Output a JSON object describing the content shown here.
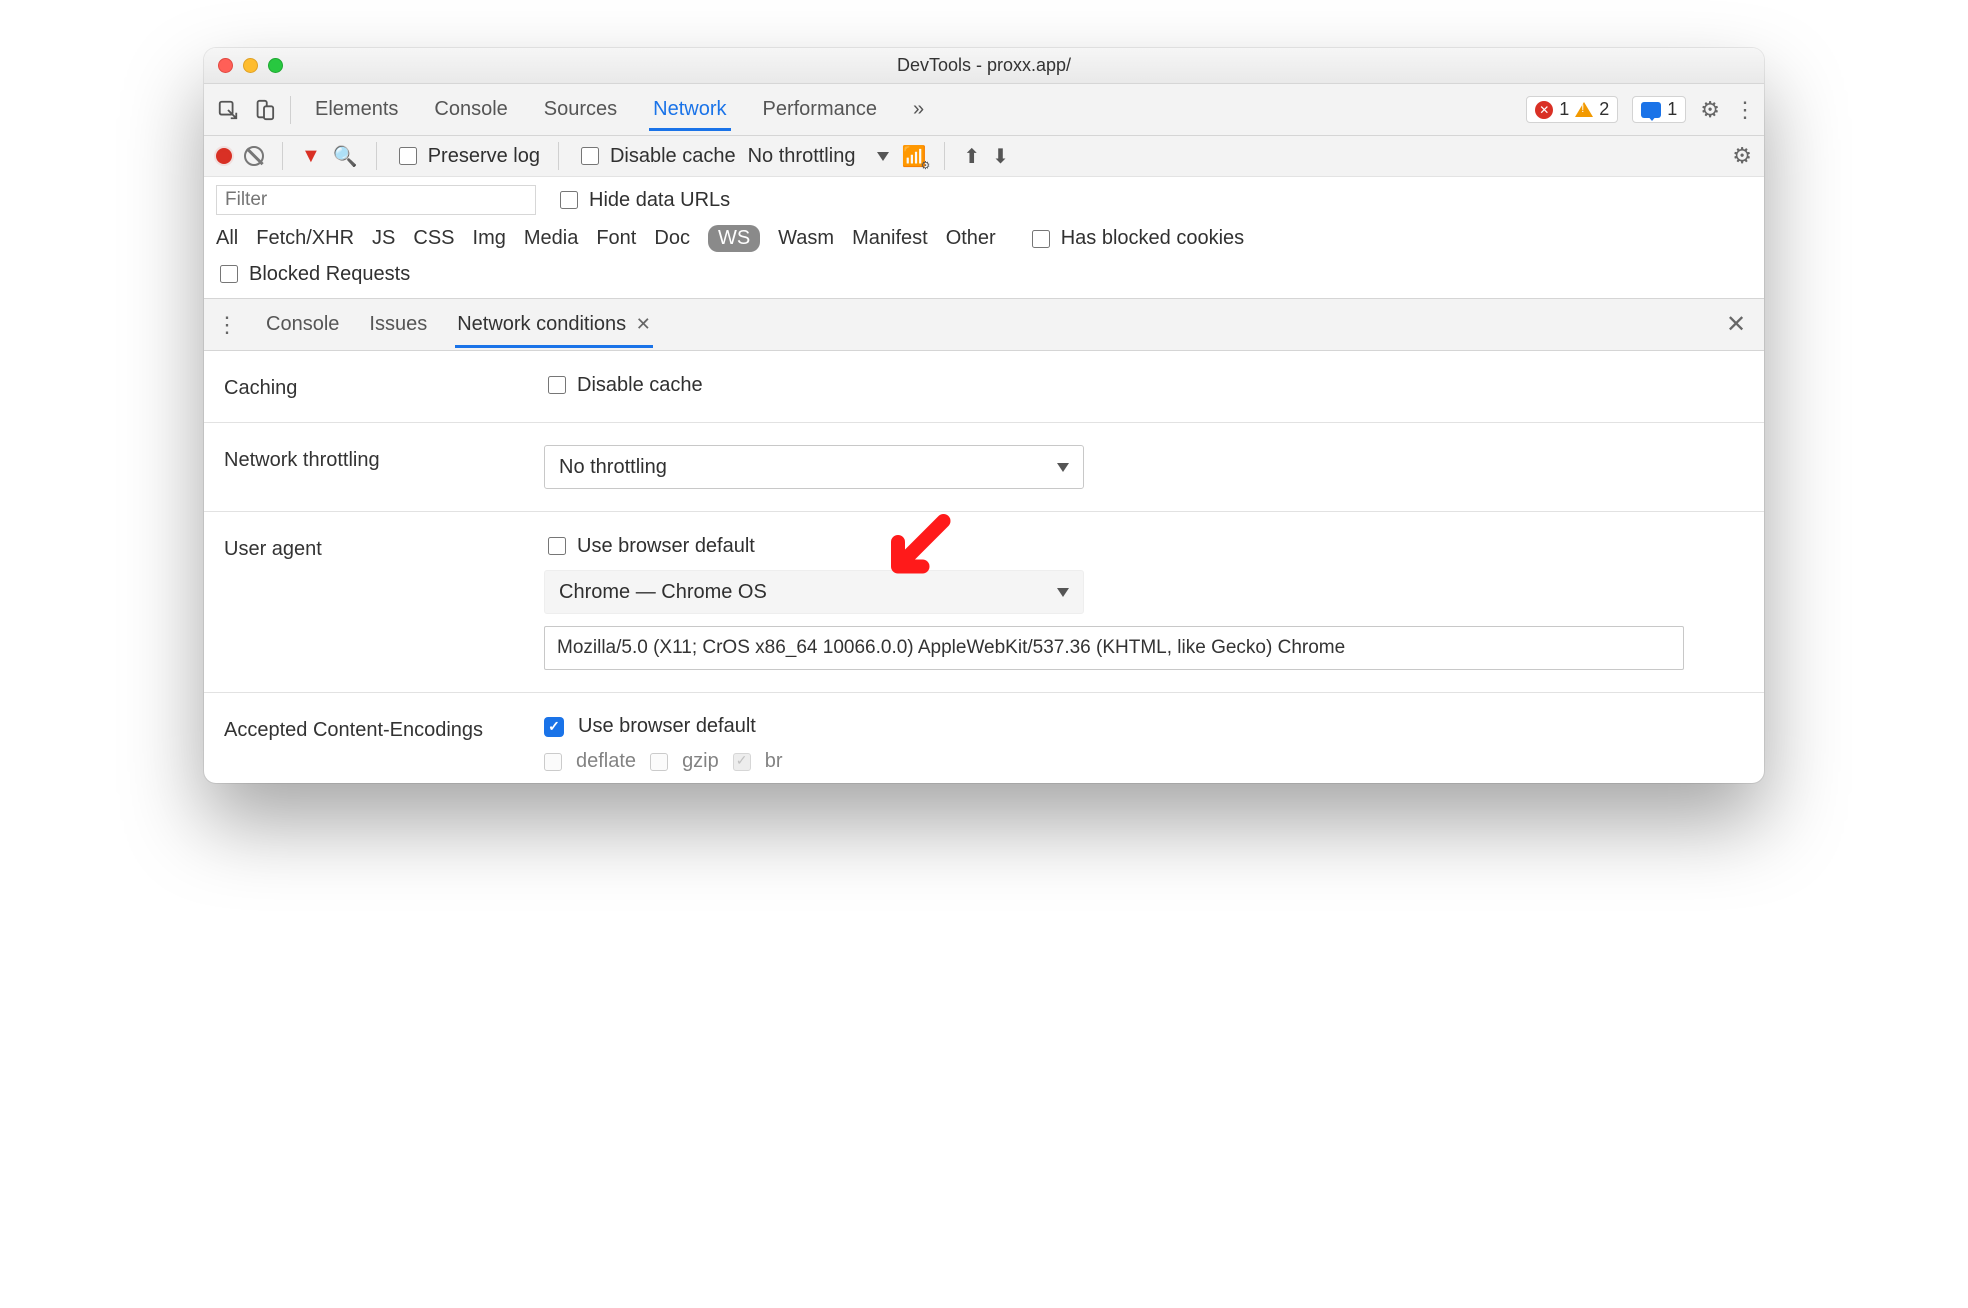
{
  "window": {
    "title": "DevTools - proxx.app/"
  },
  "toolbar": {
    "tabs": [
      "Elements",
      "Console",
      "Sources",
      "Network",
      "Performance"
    ],
    "active_tab": "Network",
    "badges": {
      "errors": "1",
      "warnings": "2",
      "messages": "1"
    }
  },
  "network_bar": {
    "preserve_log": "Preserve log",
    "disable_cache": "Disable cache",
    "throttling": "No throttling"
  },
  "filter_bar": {
    "placeholder": "Filter",
    "hide_data_urls": "Hide data URLs"
  },
  "type_filters": {
    "items": [
      "All",
      "Fetch/XHR",
      "JS",
      "CSS",
      "Img",
      "Media",
      "Font",
      "Doc",
      "WS",
      "Wasm",
      "Manifest",
      "Other"
    ],
    "active": "WS",
    "has_blocked_cookies": "Has blocked cookies",
    "blocked_requests": "Blocked Requests"
  },
  "drawer": {
    "tabs": [
      "Console",
      "Issues",
      "Network conditions"
    ],
    "active": "Network conditions"
  },
  "net_conditions": {
    "caching_label": "Caching",
    "caching_checkbox": "Disable cache",
    "throttling_label": "Network throttling",
    "throttling_value": "No throttling",
    "ua_label": "User agent",
    "ua_use_default": "Use browser default",
    "ua_select": "Chrome — Chrome OS",
    "ua_string": "Mozilla/5.0 (X11; CrOS x86_64 10066.0.0) AppleWebKit/537.36 (KHTML, like Gecko) Chrome",
    "enc_label": "Accepted Content-Encodings",
    "enc_use_default": "Use browser default",
    "enc_items": [
      "deflate",
      "gzip",
      "br"
    ]
  }
}
